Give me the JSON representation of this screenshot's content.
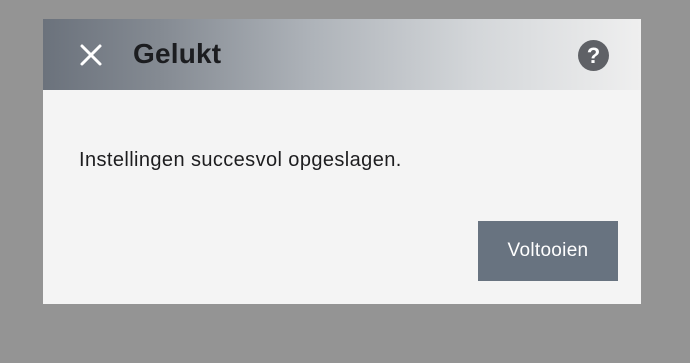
{
  "dialog": {
    "title": "Gelukt",
    "message": "Instellingen succesvol opgeslagen.",
    "finish_label": "Voltooien",
    "help_glyph": "?",
    "icons": {
      "close": "close-icon",
      "help": "help-icon"
    }
  },
  "colors": {
    "backdrop": "#949494",
    "dialog_bg": "#f4f4f4",
    "header_gradient_start": "#6b727c",
    "header_gradient_end": "#efefef",
    "button_bg": "#687380",
    "help_circle": "#5f6166"
  }
}
